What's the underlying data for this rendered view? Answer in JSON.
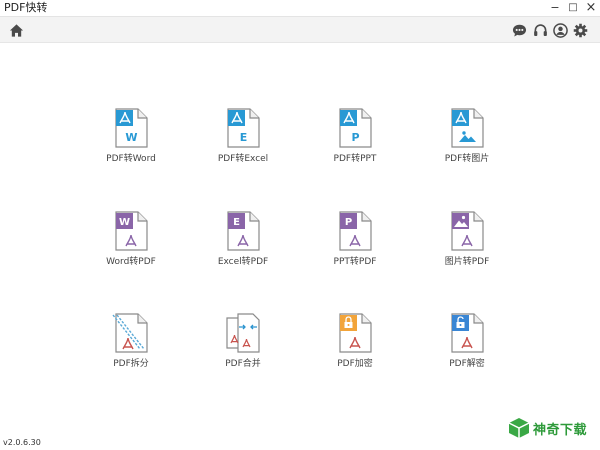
{
  "window": {
    "title": "PDF快转",
    "minimize": "−",
    "maximize": "□",
    "close": "×"
  },
  "toolbar": {
    "icons": [
      "home-icon",
      "chat-icon",
      "headset-icon",
      "user-icon",
      "gear-icon"
    ]
  },
  "colors": {
    "blue": "#2899d4",
    "purple": "#8a65a8",
    "acrobat_red": "#c8534e",
    "orange": "#f2a43a",
    "lock_blue": "#3a86d4"
  },
  "tools": [
    {
      "label": "PDF转Word",
      "badge": "W",
      "icon": "pdf-to-word-icon"
    },
    {
      "label": "PDF转Excel",
      "badge": "E",
      "icon": "pdf-to-excel-icon"
    },
    {
      "label": "PDF转PPT",
      "badge": "P",
      "icon": "pdf-to-ppt-icon"
    },
    {
      "label": "PDF转图片",
      "badge": "",
      "icon": "pdf-to-image-icon"
    },
    {
      "label": "Word转PDF",
      "badge": "W",
      "icon": "word-to-pdf-icon"
    },
    {
      "label": "Excel转PDF",
      "badge": "E",
      "icon": "excel-to-pdf-icon"
    },
    {
      "label": "PPT转PDF",
      "badge": "P",
      "icon": "ppt-to-pdf-icon"
    },
    {
      "label": "图片转PDF",
      "badge": "",
      "icon": "image-to-pdf-icon"
    },
    {
      "label": "PDF拆分",
      "badge": "",
      "icon": "pdf-split-icon"
    },
    {
      "label": "PDF合并",
      "badge": "",
      "icon": "pdf-merge-icon"
    },
    {
      "label": "PDF加密",
      "badge": "",
      "icon": "pdf-encrypt-icon"
    },
    {
      "label": "PDF解密",
      "badge": "",
      "icon": "pdf-decrypt-icon"
    }
  ],
  "footer": {
    "version": "v2.0.6.30"
  },
  "watermark": {
    "text": "神奇下载"
  }
}
